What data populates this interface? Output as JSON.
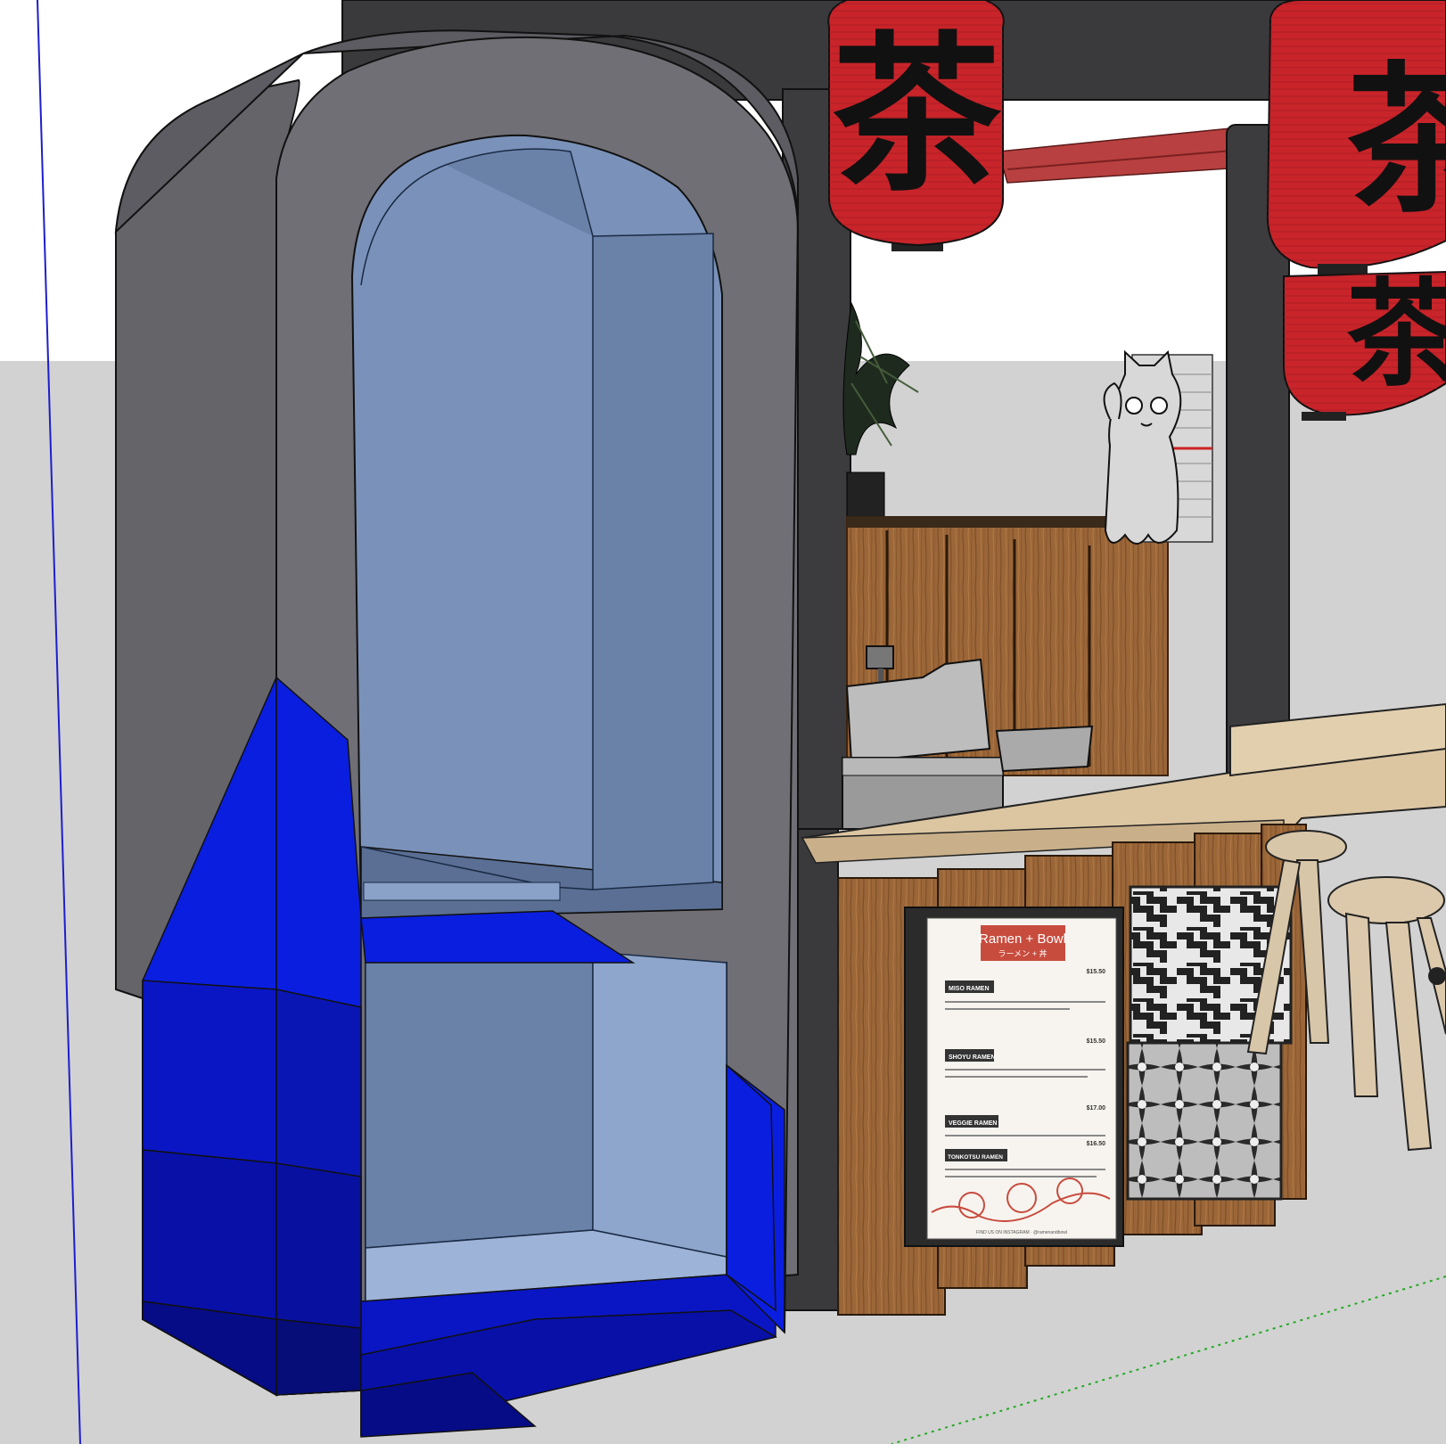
{
  "viewport": {
    "sky_color": "#ffffff",
    "ground_color": "#d2d2d2",
    "axis_blue": "#1e1ecc",
    "axis_green": "#22aa22"
  },
  "lanterns": [
    {
      "glyph": "茶",
      "color": "#c8242a"
    },
    {
      "glyph": "茶",
      "color": "#c8242a"
    },
    {
      "glyph": "茶",
      "color": "#c8242a"
    }
  ],
  "menu_board": {
    "title": "Ramen + Bowl",
    "subtitle": "ラーメン + 丼",
    "items": [
      {
        "name": "MISO RAMEN",
        "price": "$15.50"
      },
      {
        "name": "SHOYU RAMEN",
        "price": "$15.50"
      },
      {
        "name": "VEGGIE RAMEN",
        "price": "$17.00"
      },
      {
        "name": "TONKOTSU RAMEN",
        "price": "$16.50"
      }
    ],
    "footer": "FIND US ON INSTAGRAM · @ramenandbowl"
  },
  "colors": {
    "arch_gray": "#6f6f75",
    "glass": "#6a82a8",
    "blue_bright": "#0a1ee0",
    "blue_mid": "#0a16b4",
    "blue_dark": "#060c78",
    "wood": "#9a6536",
    "counter": "#dcc6a2",
    "booth_dark": "#3a3a3d"
  }
}
